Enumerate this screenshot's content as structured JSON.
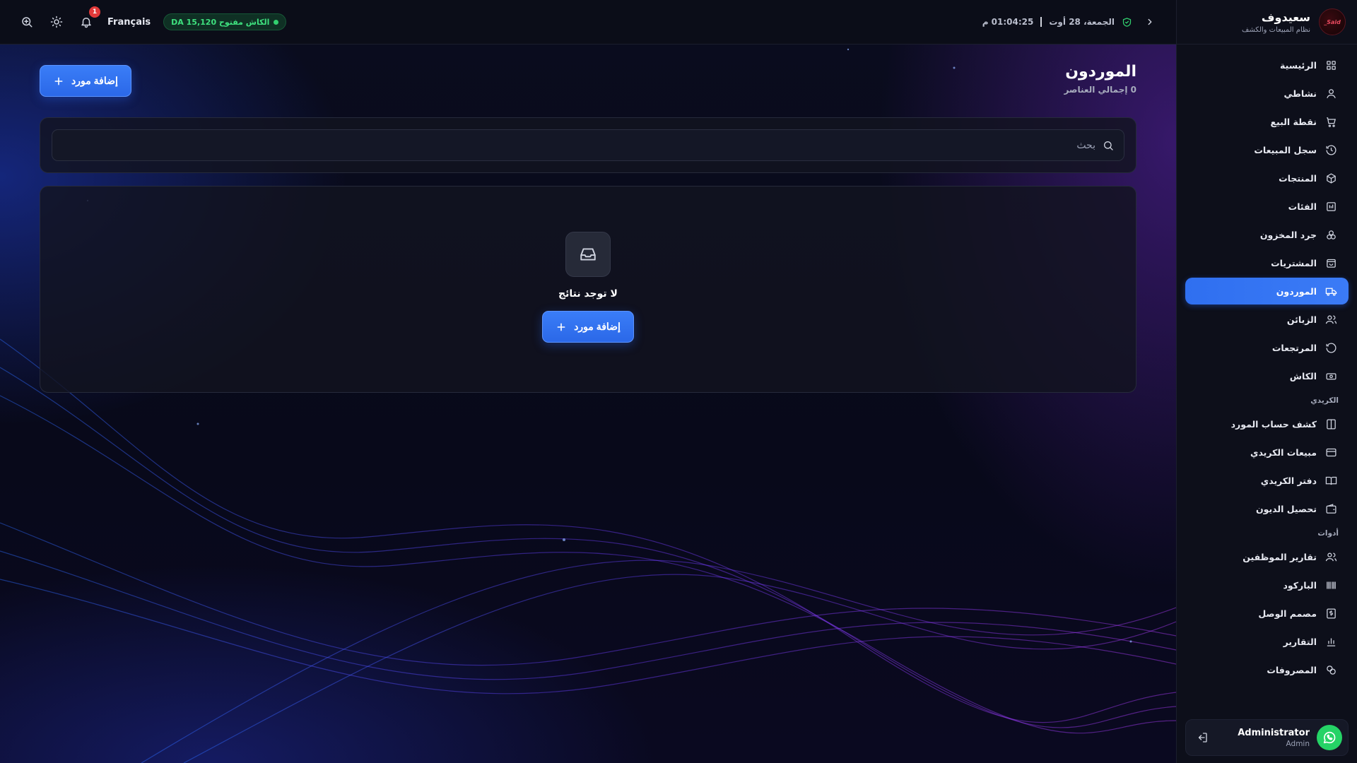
{
  "brand": {
    "name": "سعيدوف",
    "subtitle": "نظام المبيعات والكشف",
    "logo_text": "Said_"
  },
  "topbar": {
    "datetime": "الجمعة، 28 أوت",
    "time": "01:04:25 م",
    "cash_badge": "الكاش مفتوح DA 15,120",
    "language": "Français",
    "notification_count": "1"
  },
  "page": {
    "title": "الموردون",
    "subtitle": "0 إجمالي العناصر",
    "add_label": "إضافة مورد",
    "search_placeholder": "بحث",
    "empty_text": "لا توجد نتائج",
    "empty_add_label": "إضافة مورد"
  },
  "sidebar": {
    "items": [
      {
        "label": "الرئيسية",
        "icon": "grid-icon"
      },
      {
        "label": "نشاطي",
        "icon": "user-icon"
      },
      {
        "label": "نقطة البيع",
        "icon": "cart-icon"
      },
      {
        "label": "سجل المبيعات",
        "icon": "history-icon"
      },
      {
        "label": "المنتجات",
        "icon": "box-icon"
      },
      {
        "label": "الفئات",
        "icon": "category-icon"
      },
      {
        "label": "جرد المخزون",
        "icon": "stock-icon"
      },
      {
        "label": "المشتريات",
        "icon": "shopping-bag-icon"
      },
      {
        "label": "الموردون",
        "icon": "truck-icon",
        "active": true
      },
      {
        "label": "الزبائن",
        "icon": "users-icon"
      },
      {
        "label": "المرتجعات",
        "icon": "return-icon"
      },
      {
        "label": "الكاش",
        "icon": "cash-icon"
      }
    ],
    "section_credit": "الكريدي",
    "credit_items": [
      {
        "label": "كشف حساب المورد",
        "icon": "book-icon"
      },
      {
        "label": "مبيعات الكريدي",
        "icon": "card-icon"
      },
      {
        "label": "دفتر الكريدي",
        "icon": "book-open-icon"
      },
      {
        "label": "تحصيل الديون",
        "icon": "wallet-icon"
      }
    ],
    "section_tools": "أدوات",
    "tool_items": [
      {
        "label": "تقارير الموظفين",
        "icon": "team-icon"
      },
      {
        "label": "الباركود",
        "icon": "barcode-icon"
      },
      {
        "label": "مصمم الوصل",
        "icon": "receipt-icon"
      },
      {
        "label": "التقارير",
        "icon": "chart-icon"
      },
      {
        "label": "المصروفات",
        "icon": "expenses-icon"
      }
    ],
    "user": {
      "name": "Administrator",
      "role": "Admin"
    }
  },
  "colors": {
    "accent": "#2f6ff0",
    "success": "#32d06f",
    "danger": "#e23a3a"
  }
}
